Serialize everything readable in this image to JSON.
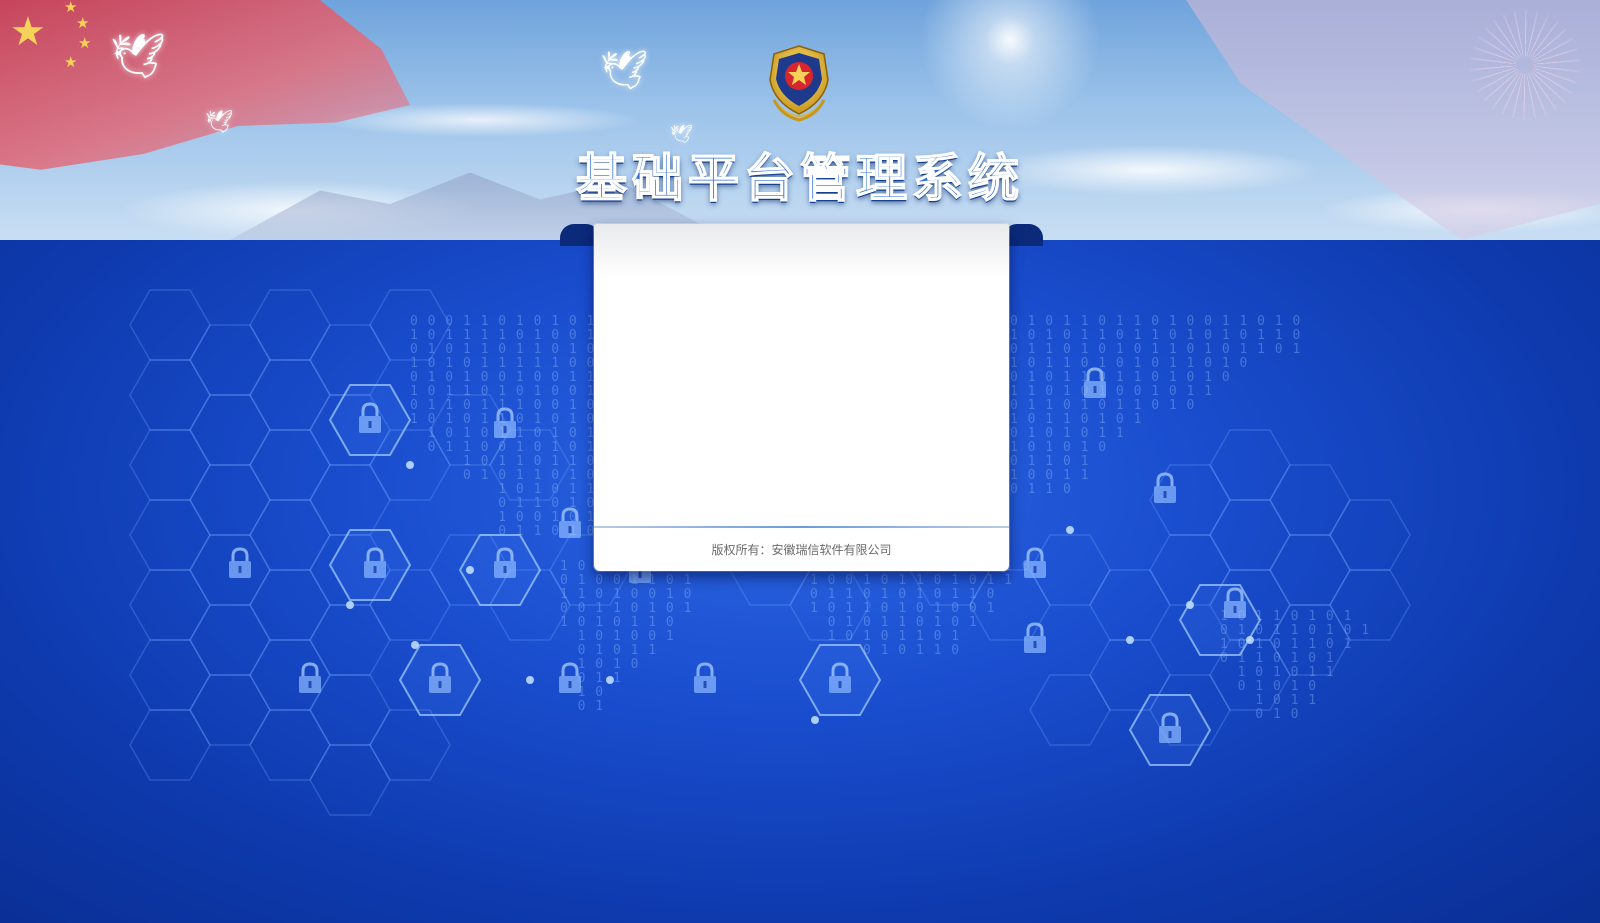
{
  "header": {
    "title": "基础平台管理系统",
    "emblem_icon": "police-emblem-icon"
  },
  "login_card": {
    "copyright": "版权所有：安徽瑞信软件有限公司"
  },
  "background": {
    "decor_icon": "padlock-icon",
    "colors": {
      "primary_blue": "#1a4ecf",
      "dark_blue": "#0a2f94",
      "card_white": "#ffffff",
      "flag_red": "#d03a4d",
      "gold": "#f6d258"
    }
  }
}
